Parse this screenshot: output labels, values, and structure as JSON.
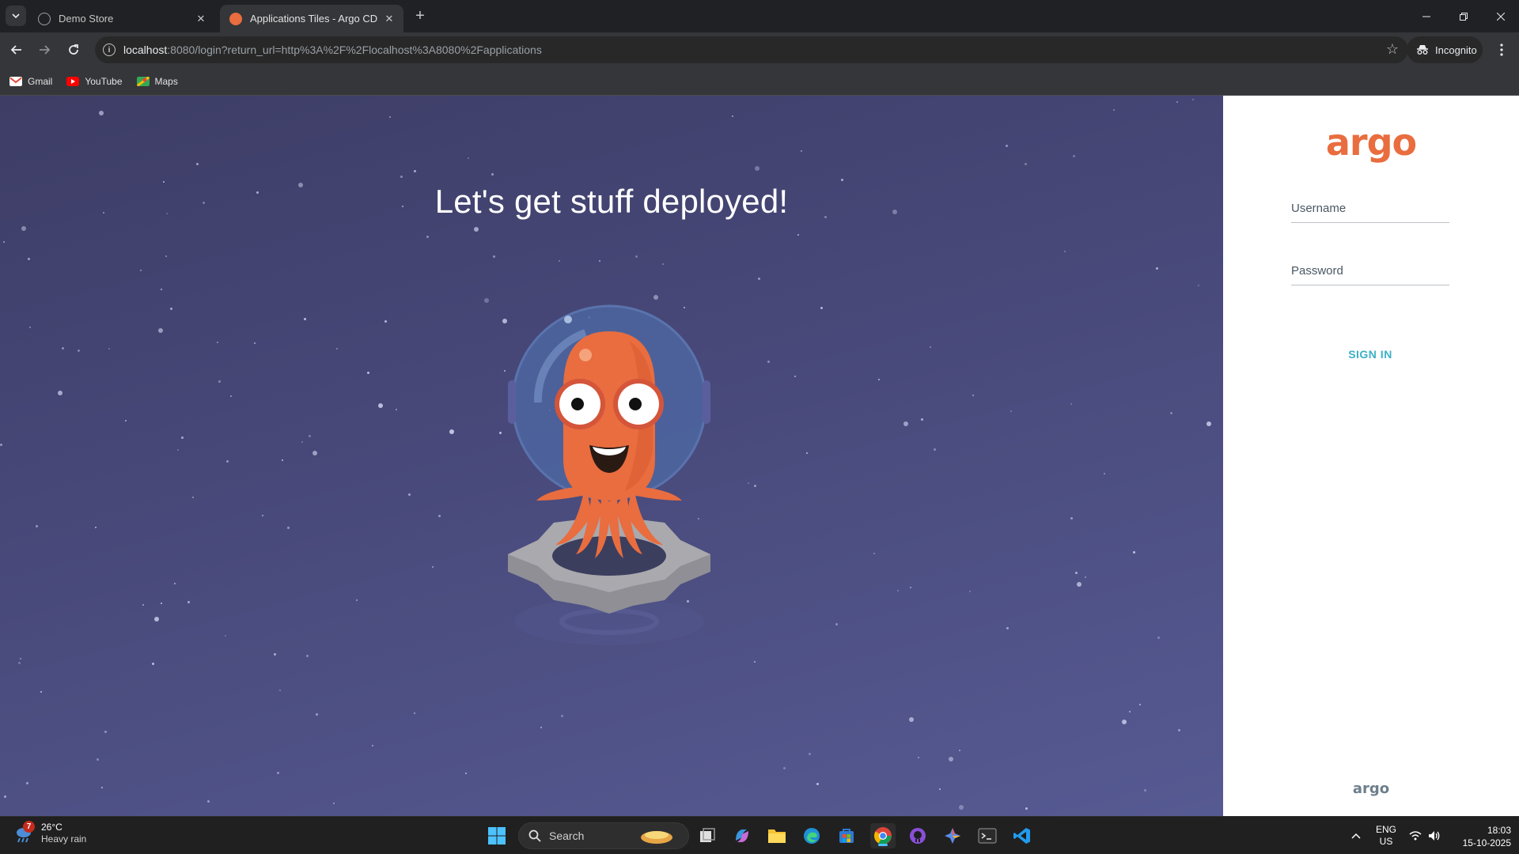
{
  "browser": {
    "tabs": [
      {
        "title": "Demo Store",
        "active": false
      },
      {
        "title": "Applications Tiles - Argo CD",
        "active": true
      }
    ],
    "url_host": "localhost",
    "url_rest": ":8080/login?return_url=http%3A%2F%2Flocalhost%3A8080%2Fapplications",
    "incognito_label": "Incognito",
    "bookmarks": [
      {
        "label": "Gmail",
        "icon": "gmail-icon"
      },
      {
        "label": "YouTube",
        "icon": "youtube-icon"
      },
      {
        "label": "Maps",
        "icon": "maps-icon"
      }
    ]
  },
  "hero": {
    "title": "Let's get stuff deployed!"
  },
  "login": {
    "logo": "argo",
    "username_placeholder": "Username",
    "password_placeholder": "Password",
    "signin_label": "SIGN IN",
    "footer_logo": "argo",
    "link_color": "#3bb1c5",
    "brand_color": "#e96d3f"
  },
  "taskbar": {
    "weather_badge": "7",
    "temperature": "26°C",
    "condition": "Heavy rain",
    "search_placeholder": "Search",
    "lang_top": "ENG",
    "lang_bottom": "US",
    "time": "18:03",
    "date": "15-10-2025"
  }
}
